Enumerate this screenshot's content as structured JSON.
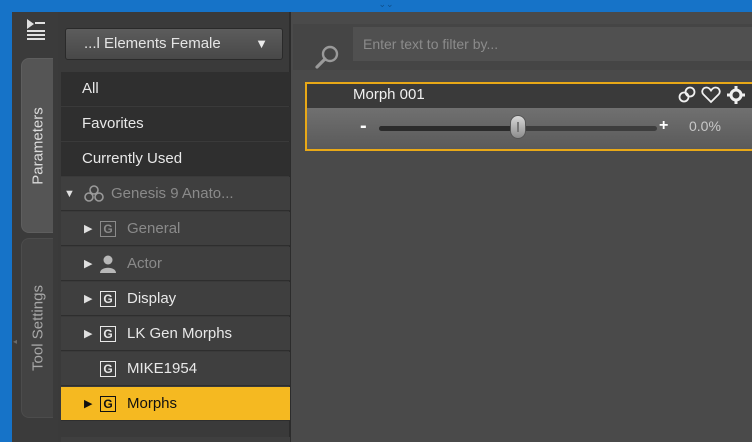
{
  "tabs": {
    "parameters_label": "Parameters",
    "tool_settings_label": "Tool Settings"
  },
  "preset_dropdown": {
    "label": "...l Elements Female"
  },
  "filters": {
    "all": "All",
    "favorites": "Favorites",
    "currently_used": "Currently Used"
  },
  "tree": {
    "root": {
      "label": "Genesis 9 Anato...",
      "icon": "figure-icon"
    },
    "items": [
      {
        "label": "General",
        "icon": "group-icon",
        "dim": true
      },
      {
        "label": "Actor",
        "icon": "actor-icon",
        "dim": true
      },
      {
        "label": "Display",
        "icon": "group-icon",
        "dim": false
      },
      {
        "label": "LK Gen Morphs",
        "icon": "group-icon",
        "dim": false
      },
      {
        "label": "MIKE1954",
        "icon": "group-icon",
        "dim": false
      },
      {
        "label": "Morphs",
        "icon": "group-icon",
        "dim": false,
        "selected": true
      }
    ],
    "group_glyph": "G"
  },
  "filter": {
    "placeholder": "Enter text to filter by..."
  },
  "morph": {
    "name": "Morph 001",
    "minus": "-",
    "plus": "+",
    "value_text": "0.0%",
    "slider_fraction": 0.5
  },
  "colors": {
    "frame_blue": "#1673c8",
    "selected_yellow": "#f5b921",
    "card_border": "#e8a817"
  }
}
